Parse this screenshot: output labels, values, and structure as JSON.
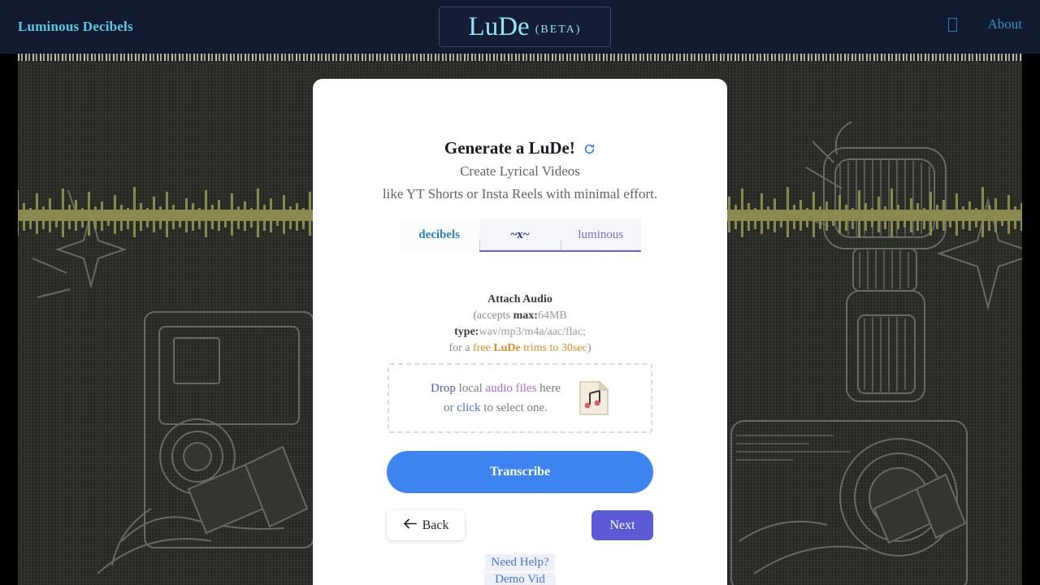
{
  "navbar": {
    "brand": "Luminous Decibels",
    "logo_main": "LuDe",
    "logo_beta": "(BETA)",
    "tofu_icon": "missing-glyph-icon",
    "about_label": "About",
    "brand_color": "#5bc8e8",
    "logo_color": "#93e4f5",
    "about_color": "#2f8fc9",
    "background_color": "#111a2e"
  },
  "card": {
    "title": "Generate a LuDe!",
    "refresh_icon": "refresh-icon",
    "subtitle_1": "Create Lyrical Videos",
    "subtitle_2": "like YT Shorts or Insta Reels with minimal effort.",
    "tabs": [
      {
        "label": "decibels",
        "active": true,
        "color": "#2f7fc0"
      },
      {
        "label": "~x~",
        "active": false,
        "color": "#2c3a86"
      },
      {
        "label": "luminous",
        "active": false,
        "color": "#7a6fcf"
      }
    ],
    "tab_underline_color": "#6a63d8",
    "attach": {
      "title": "Attach Audio",
      "line1_open": "(accepts ",
      "line1_key": "max:",
      "line1_value": "64MB",
      "line2_key": "type:",
      "line2_value": "wav/mp3/m4a/aac/flac;",
      "line3_prefix": "for a ",
      "line3_free": "free ",
      "line3_lude": "LuDe",
      "line3_rest": " trims to 30sec",
      "line3_close": ")",
      "accent_color": "#e08b2a"
    },
    "dropzone": {
      "drop_word": "Drop",
      "local_word": " local ",
      "audio_files_word": "audio files",
      "here_word": " here",
      "or_word": "or ",
      "click_word": "click",
      "select_word": " to select one.",
      "file_icon": "audio-file-icon"
    },
    "buttons": {
      "transcribe": "Transcribe",
      "transcribe_color": "#3d84f0",
      "back": "Back",
      "back_arrow_icon": "arrow-left-icon",
      "next": "Next",
      "next_color": "#5b5bd6"
    },
    "help": {
      "need_help": "Need Help?",
      "demo_video": "Demo Vid"
    }
  },
  "background": {
    "base_color": "#2b2e28",
    "waveform_color": "#8f8e52",
    "line_art_color": "#9a9a93",
    "description": "dark textured canvas with olive audio waveform and line-art camera / megaphone / microphone illustrations"
  }
}
